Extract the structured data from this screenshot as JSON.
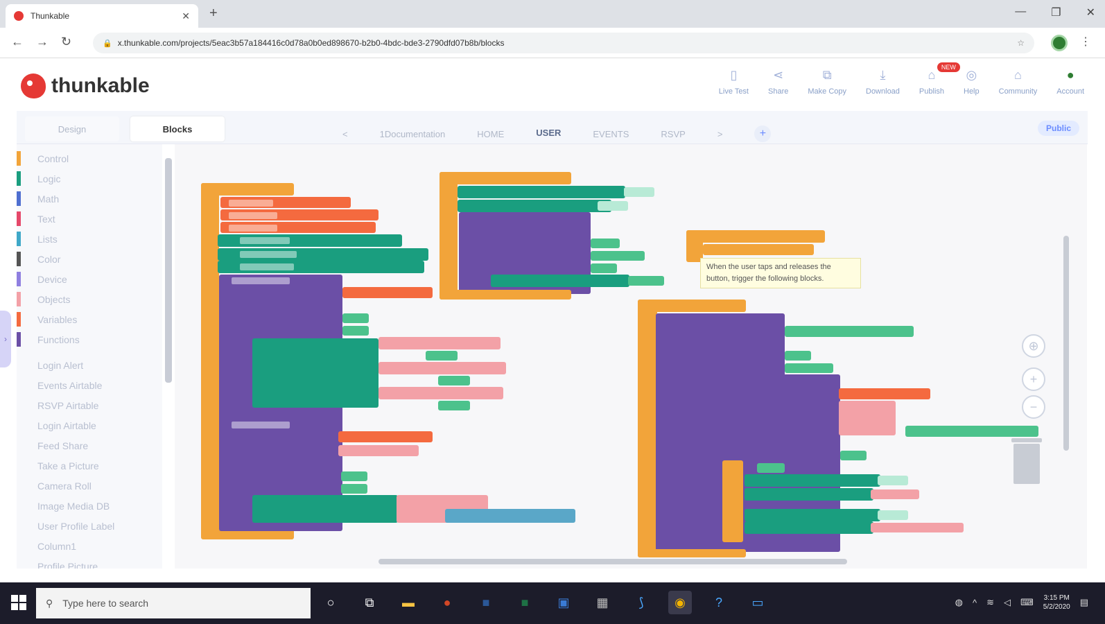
{
  "browser": {
    "tab_title": "Thunkable",
    "url": "x.thunkable.com/projects/5eac3b57a184416c0d78a0b0ed898670-b2b0-4bdc-bde3-2790dfd07b8b/blocks"
  },
  "header": {
    "logo_text": "thunkable",
    "actions": [
      {
        "label": "Live Test"
      },
      {
        "label": "Share"
      },
      {
        "label": "Make Copy"
      },
      {
        "label": "Download"
      },
      {
        "label": "Publish",
        "badge": "NEW"
      },
      {
        "label": "Help"
      },
      {
        "label": "Community"
      },
      {
        "label": "Account"
      }
    ]
  },
  "workbar": {
    "design_tab": "Design",
    "blocks_tab": "Blocks",
    "prev_arrow": "<",
    "screens": [
      "1Documentation",
      "HOME",
      "USER",
      "EVENTS",
      "RSVP"
    ],
    "active_screen": "USER",
    "next_arrow": ">",
    "add_screen": "+",
    "visibility_badge": "Public"
  },
  "palette": {
    "core": [
      {
        "label": "Control",
        "color": "#f2a43a"
      },
      {
        "label": "Logic",
        "color": "#1a9e7f"
      },
      {
        "label": "Math",
        "color": "#4f6fd0"
      },
      {
        "label": "Text",
        "color": "#e5486a"
      },
      {
        "label": "Lists",
        "color": "#3fa8c8"
      },
      {
        "label": "Color",
        "color": "#555555"
      },
      {
        "label": "Device",
        "color": "#8f7fe0"
      },
      {
        "label": "Objects",
        "color": "#f3a1a7"
      },
      {
        "label": "Variables",
        "color": "#f46a3f"
      },
      {
        "label": "Functions",
        "color": "#6b4fa6"
      }
    ],
    "components": [
      "Login Alert",
      "Events Airtable",
      "RSVP Airtable",
      "Login Airtable",
      "Feed Share",
      "Take a Picture",
      "Camera Roll",
      "Image Media DB",
      "User Profile Label",
      "Column1",
      "Profile Picture"
    ]
  },
  "tooltip": {
    "text": "When the user taps and releases the button, trigger the following blocks."
  },
  "canvas_controls": {
    "recenter": "⊕",
    "zoom_in": "+",
    "zoom_out": "−"
  },
  "taskbar": {
    "search_placeholder": "Type here to search",
    "time": "3:15 PM",
    "date": "5/2/2020"
  },
  "colors": {
    "control": "#f2a43a",
    "variables": "#f46a3f",
    "functions": "#6b4fa6",
    "logic": "#1a9e7f",
    "accent": "#6b8cff"
  }
}
